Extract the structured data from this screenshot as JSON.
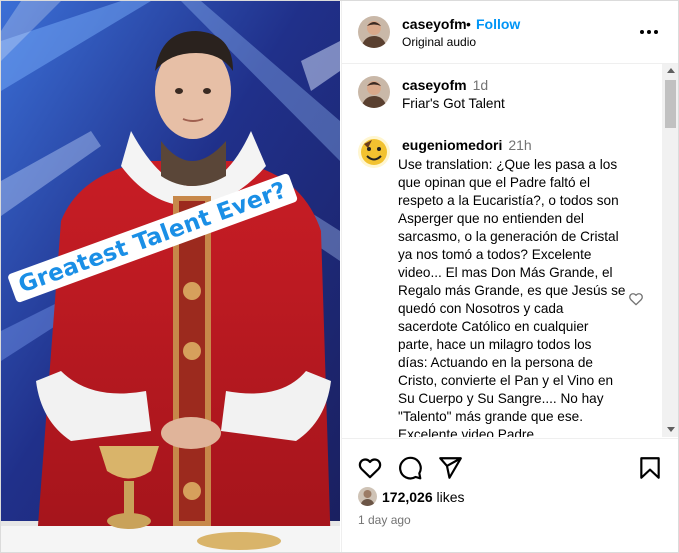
{
  "header": {
    "username": "caseyofm",
    "separator": "•",
    "follow_label": "Follow",
    "audio_label": "Original audio",
    "more_icon": "more-horizontal-icon"
  },
  "media": {
    "overlay_text": "Greatest Talent Ever?"
  },
  "caption": {
    "username": "caseyofm",
    "time": "1d",
    "text": "Friar's Got Talent"
  },
  "comments": [
    {
      "username": "eugeniomedori",
      "time": "21h",
      "lines": [
        "Use translation: ¿Que les pasa a los",
        "que opinan que el Padre faltó el",
        "respeto a la Eucaristía?, o todos son",
        "Asperger que no entienden del",
        "sarcasmo, o la generación de Cristal",
        "ya nos tomó a todos? Excelente",
        "video... El mas Don Más Grande, el",
        "Regalo más Grande, es que Jesús se",
        "quedó con Nosotros y cada",
        "sacerdote Católico en cualquier",
        "parte, hace un milagro todos los",
        "días: Actuando en la persona de",
        "Cristo, convierte el Pan y el Vino en",
        "Su Cuerpo y Su Sangre.... No hay",
        "\"Talento\" más grande que ese.",
        "Excelente video Padre."
      ]
    }
  ],
  "actions": {
    "like_icon": "heart-icon",
    "comment_icon": "comment-icon",
    "share_icon": "send-icon",
    "save_icon": "bookmark-icon"
  },
  "likes": {
    "count": "172,026",
    "word": "likes"
  },
  "date": "1 day ago"
}
